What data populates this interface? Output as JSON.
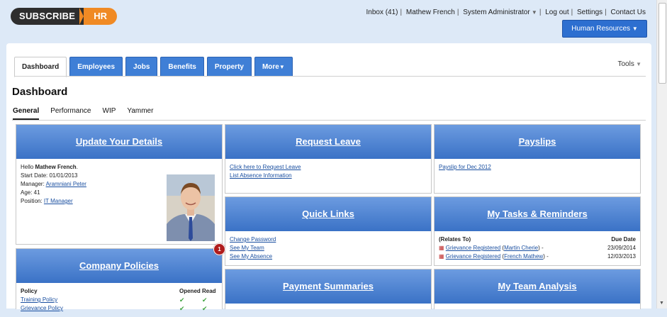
{
  "logo": {
    "left": "SUBSCRIBE",
    "right": "HR"
  },
  "toplinks": {
    "inbox": "Inbox (41)",
    "user": "Mathew French",
    "role": "System Administrator",
    "logout": "Log out",
    "settings": "Settings",
    "contact": "Contact Us"
  },
  "module_button": "Human Resources",
  "tabs": [
    "Dashboard",
    "Employees",
    "Jobs",
    "Benefits",
    "Property",
    "More"
  ],
  "tools": "Tools",
  "page_title": "Dashboard",
  "subtabs": [
    "General",
    "Performance",
    "WIP",
    "Yammer"
  ],
  "widgets": {
    "update": {
      "title": "Update Your Details",
      "hello_prefix": "Hello ",
      "hello_name": "Mathew French",
      "start_date": "Start Date: 01/01/2013",
      "manager_label": "Manager: ",
      "manager": "Aramniani Peter",
      "age": "Age: 41",
      "position_label": "Position: ",
      "position": "IT Manager"
    },
    "leave": {
      "title": "Request Leave",
      "link1": "Click here to Request Leave",
      "link2": "List Absence Information"
    },
    "payslips": {
      "title": "Payslips",
      "link1": "Payslip for Dec 2012"
    },
    "quicklinks": {
      "title": "Quick Links",
      "links": [
        "Change Password",
        "See My Team",
        "See My Absence"
      ]
    },
    "tasks": {
      "title": "My Tasks & Reminders",
      "col1": "(Relates To)",
      "col2": "Due Date",
      "rows": [
        {
          "item": "Grievance Registered",
          "person": "Martin Cherie",
          "date": "23/09/2014"
        },
        {
          "item": "Grievance Registered",
          "person": "French Mathew",
          "date": "12/03/2013"
        }
      ]
    },
    "policies": {
      "title": "Company Policies",
      "col1": "Policy",
      "col2": "Opened",
      "col3": "Read",
      "rows": [
        "Training Policy",
        "Grievance Policy"
      ],
      "badge": "1"
    },
    "payment": {
      "title": "Payment Summaries"
    },
    "team": {
      "title": "My Team Analysis"
    }
  }
}
